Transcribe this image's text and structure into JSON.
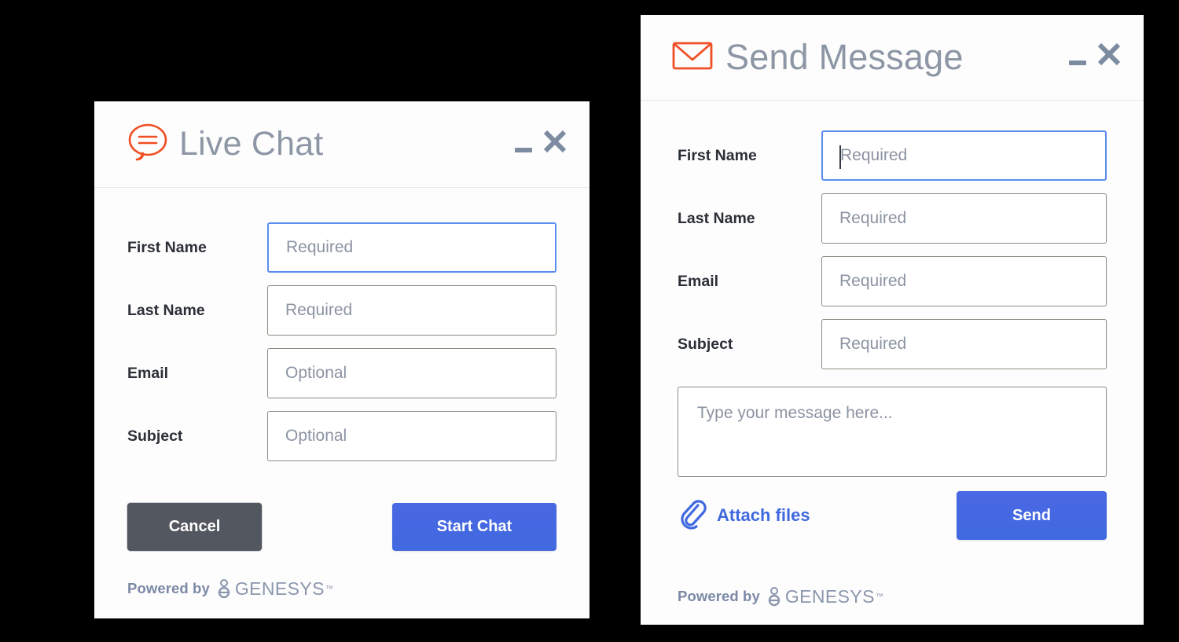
{
  "live_chat": {
    "title": "Live Chat",
    "icon": "chat-bubble-icon",
    "accent_color": "#f04e23",
    "window_controls": {
      "minimize": "minimize-icon",
      "close": "close-icon"
    },
    "fields": [
      {
        "label": "First Name",
        "placeholder": "Required",
        "focused": true,
        "caret": false
      },
      {
        "label": "Last Name",
        "placeholder": "Required",
        "focused": false,
        "caret": false
      },
      {
        "label": "Email",
        "placeholder": "Optional",
        "focused": false,
        "caret": false
      },
      {
        "label": "Subject",
        "placeholder": "Optional",
        "focused": false,
        "caret": false
      }
    ],
    "buttons": {
      "cancel": "Cancel",
      "primary": "Start Chat",
      "cancel_color": "#53575f",
      "primary_color": "#4069e0"
    },
    "footer": {
      "powered_by": "Powered by",
      "brand": "GENESYS",
      "trademark": "™"
    }
  },
  "send_message": {
    "title": "Send Message",
    "icon": "envelope-icon",
    "accent_color": "#f04e23",
    "window_controls": {
      "minimize": "minimize-icon",
      "close": "close-icon"
    },
    "fields": [
      {
        "label": "First Name",
        "placeholder": "Required",
        "focused": true,
        "caret": true
      },
      {
        "label": "Last Name",
        "placeholder": "Required",
        "focused": false,
        "caret": false
      },
      {
        "label": "Email",
        "placeholder": "Required",
        "focused": false,
        "caret": false
      },
      {
        "label": "Subject",
        "placeholder": "Required",
        "focused": false,
        "caret": false
      }
    ],
    "message": {
      "placeholder": "Type your message here..."
    },
    "attach": {
      "label": "Attach files",
      "icon": "paperclip-icon",
      "color": "#4069e0"
    },
    "buttons": {
      "primary": "Send",
      "primary_color": "#4069e0"
    },
    "footer": {
      "powered_by": "Powered by",
      "brand": "GENESYS",
      "trademark": "™"
    }
  }
}
